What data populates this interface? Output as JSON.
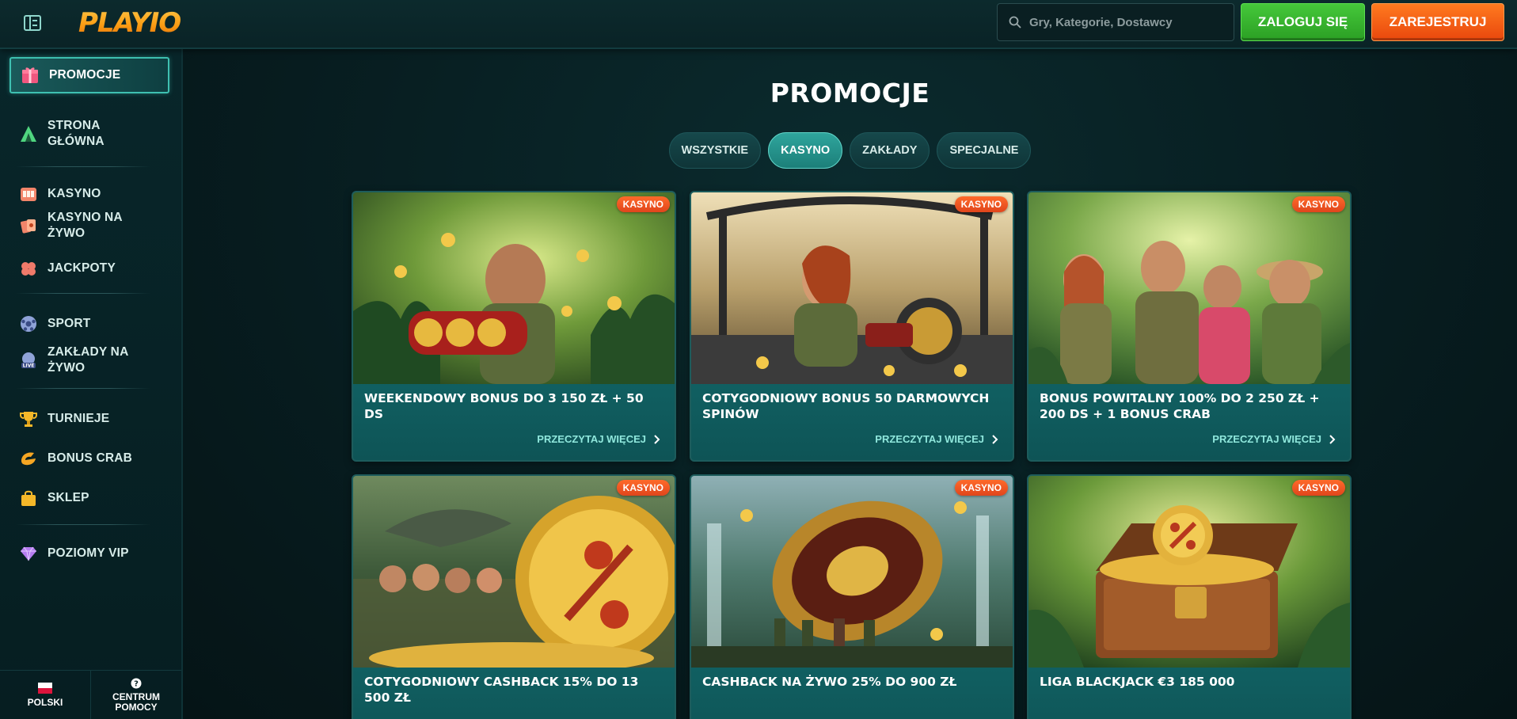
{
  "header": {
    "logo_text": "PLAYIO",
    "search_placeholder": "Gry, Kategorie, Dostawcy",
    "login_label": "ZALOGUJ SIĘ",
    "register_label": "ZAREJESTRUJ"
  },
  "sidebar": {
    "items": [
      {
        "label": "PROMOCJE",
        "icon": "gift-icon",
        "active": true
      },
      {
        "label": "STRONA\nGŁÓWNA",
        "icon": "tent-icon"
      },
      {
        "label": "KASYNO",
        "icon": "slot-machine-icon"
      },
      {
        "label": "KASYNO NA\nŻYWO",
        "icon": "cards-icon"
      },
      {
        "label": "JACKPOTY",
        "icon": "clover-icon"
      },
      {
        "label": "SPORT",
        "icon": "football-icon"
      },
      {
        "label": "ZAKŁADY NA\nŻYWO",
        "icon": "live-icon"
      },
      {
        "label": "TURNIEJE",
        "icon": "trophy-icon"
      },
      {
        "label": "BONUS CRAB",
        "icon": "crab-claw-icon"
      },
      {
        "label": "SKLEP",
        "icon": "shopping-bag-icon"
      },
      {
        "label": "POZIOMY VIP",
        "icon": "diamond-icon"
      }
    ],
    "footer": {
      "language_label": "POLSKI",
      "help_label": "CENTRUM POMOCY"
    }
  },
  "main": {
    "title": "PROMOCJE",
    "tabs": [
      {
        "label": "WSZYSTKIE"
      },
      {
        "label": "KASYNO",
        "active": true
      },
      {
        "label": "ZAKŁADY"
      },
      {
        "label": "SPECJALNE"
      }
    ],
    "read_more_label": "PRZECZYTAJ WIĘCEJ",
    "cards": [
      {
        "badge": "KASYNO",
        "title": "WEEKENDOWY BONUS DO 3 150 ZŁ + 50 DS"
      },
      {
        "badge": "KASYNO",
        "title": "COTYGODNIOWY BONUS 50 DARMOWYCH SPINÓW"
      },
      {
        "badge": "KASYNO",
        "title": "BONUS POWITALNY 100% DO 2 250 ZŁ + 200 DS + 1 BONUS CRAB"
      },
      {
        "badge": "KASYNO",
        "title": "COTYGODNIOWY CASHBACK 15% DO 13 500 ZŁ"
      },
      {
        "badge": "KASYNO",
        "title": "CASHBACK NA ŻYWO 25% DO 900 ZŁ"
      },
      {
        "badge": "KASYNO",
        "title": "LIGA BLACKJACK €3 185 000"
      }
    ]
  },
  "colors": {
    "accent_teal": "#3ec0b1",
    "login_green": "#2b9f24",
    "register_orange": "#e9470d",
    "badge_orange": "#e0451c"
  }
}
